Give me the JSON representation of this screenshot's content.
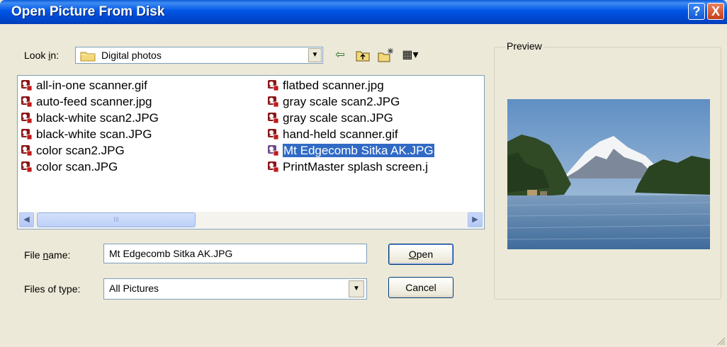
{
  "window": {
    "title": "Open Picture From Disk",
    "help_glyph": "?",
    "close_glyph": "X"
  },
  "lookin": {
    "label_pre": "Look ",
    "label_key": "i",
    "label_post": "n:",
    "value": "Digital photos",
    "dropdown_glyph": "▼"
  },
  "toolbar": {
    "back_glyph": "⇦",
    "up_glyph": "⮤",
    "newfolder_glyph": "✶",
    "views_glyph": "▦▾"
  },
  "files": [
    {
      "name": "all-in-one scanner.gif",
      "selected": false
    },
    {
      "name": "auto-feed scanner.jpg",
      "selected": false
    },
    {
      "name": "black-white scan2.JPG",
      "selected": false
    },
    {
      "name": "black-white scan.JPG",
      "selected": false
    },
    {
      "name": "color scan2.JPG",
      "selected": false
    },
    {
      "name": "color scan.JPG",
      "selected": false
    },
    {
      "name": "flatbed scanner.jpg",
      "selected": false
    },
    {
      "name": "gray scale scan2.JPG",
      "selected": false
    },
    {
      "name": "gray scale scan.JPG",
      "selected": false
    },
    {
      "name": "hand-held scanner.gif",
      "selected": false
    },
    {
      "name": "Mt Edgecomb Sitka AK.JPG",
      "selected": true
    },
    {
      "name": "PrintMaster splash screen.j",
      "selected": false
    }
  ],
  "scroll": {
    "left_glyph": "◀",
    "right_glyph": "▶",
    "thumb_glyph": "III"
  },
  "filename": {
    "label_pre": "File ",
    "label_key": "n",
    "label_post": "ame:",
    "value": "Mt Edgecomb Sitka AK.JPG"
  },
  "filetype": {
    "label": "Files of type:",
    "value": "All Pictures",
    "dropdown_glyph": "▼"
  },
  "buttons": {
    "open_key": "O",
    "open_rest": "pen",
    "cancel": "Cancel"
  },
  "preview": {
    "legend": "Preview"
  },
  "colors": {
    "titlebar": "#0055e5",
    "selection": "#316ac5",
    "dialog_bg": "#ece9d8"
  }
}
